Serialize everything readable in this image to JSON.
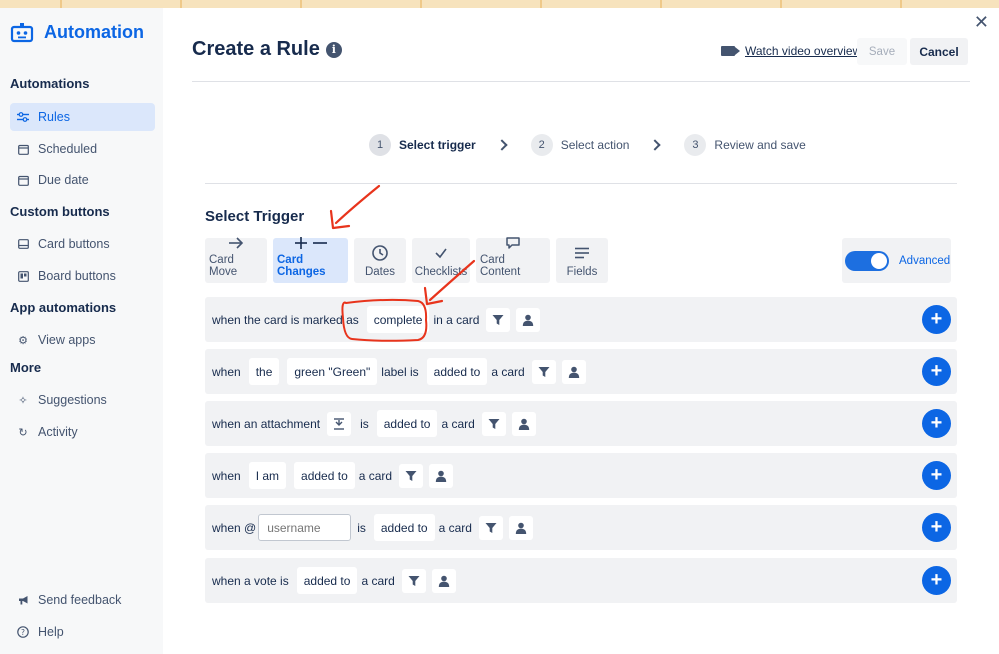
{
  "sidebar": {
    "app_title": "Automation",
    "sections": [
      {
        "heading": "Automations",
        "items": [
          {
            "label": "Rules",
            "icon": "sliders-icon",
            "active": true
          },
          {
            "label": "Scheduled",
            "icon": "calendar-icon"
          },
          {
            "label": "Due date",
            "icon": "calendar-icon"
          }
        ]
      },
      {
        "heading": "Custom buttons",
        "items": [
          {
            "label": "Card buttons",
            "icon": "card-icon"
          },
          {
            "label": "Board buttons",
            "icon": "board-icon"
          }
        ]
      },
      {
        "heading": "App automations",
        "items": [
          {
            "label": "View apps",
            "icon": "gear-icon"
          }
        ]
      },
      {
        "heading": "More",
        "items": [
          {
            "label": "Suggestions",
            "icon": "sparkle-icon"
          },
          {
            "label": "Activity",
            "icon": "refresh-icon"
          }
        ]
      }
    ],
    "footer": [
      {
        "label": "Send feedback",
        "icon": "megaphone-icon"
      },
      {
        "label": "Help",
        "icon": "help-icon"
      }
    ]
  },
  "header": {
    "title": "Create a Rule",
    "watch_label": "Watch video overview",
    "save_label": "Save",
    "cancel_label": "Cancel"
  },
  "steps": [
    {
      "num": "1",
      "label": "Select trigger"
    },
    {
      "num": "2",
      "label": "Select action"
    },
    {
      "num": "3",
      "label": "Review and save"
    }
  ],
  "trigger": {
    "heading": "Select Trigger",
    "tabs": [
      "Card Move",
      "Card Changes",
      "Dates",
      "Checklists",
      "Card Content",
      "Fields"
    ],
    "active_tab": "Card Changes",
    "advanced_label": "Advanced",
    "advanced_on": true,
    "rows": {
      "r1": {
        "t1": "when the card is marked as",
        "p1": "complete",
        "t2": "in a card"
      },
      "r2": {
        "t1": "when",
        "p1": "the",
        "p2": "green \"Green\"",
        "t2": "label is",
        "p3": "added to",
        "t3": "a card"
      },
      "r3": {
        "t1": "when an attachment",
        "t2": "is",
        "p1": "added to",
        "t3": "a card"
      },
      "r4": {
        "t1": "when",
        "p1": "I am",
        "p2": "added to",
        "t2": "a card"
      },
      "r5": {
        "t1": "when @",
        "placeholder": "username",
        "t2": "is",
        "p1": "added to",
        "t3": "a card"
      },
      "r6": {
        "t1": "when a vote is",
        "p1": "added to",
        "t2": "a card"
      }
    }
  },
  "colors": {
    "accent": "#0c66e4",
    "annotation": "#e8341c",
    "active_tab_bg": "#dbe7fb"
  }
}
